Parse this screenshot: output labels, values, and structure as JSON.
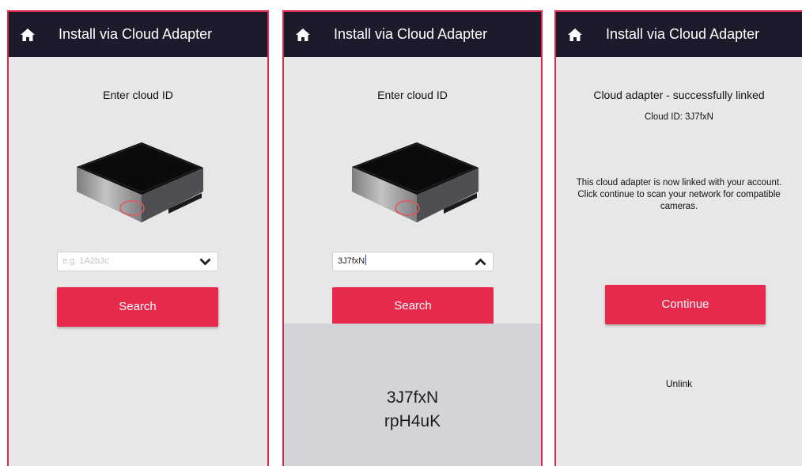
{
  "app_title": "Install via Cloud Adapter",
  "colors": {
    "accent": "#e7294c",
    "topbar": "#1b1b2c",
    "background": "#e7e7e8"
  },
  "icons": {
    "home": "home-icon",
    "dropdown_closed": "chevron-down-icon",
    "dropdown_open": "chevron-up-icon"
  },
  "screen1": {
    "heading": "Enter cloud ID",
    "dropdown_placeholder": "e.g. 1A2b3c",
    "search_label": "Search"
  },
  "screen2": {
    "heading": "Enter cloud ID",
    "dropdown_value": "3J7fxN",
    "search_label": "Search",
    "picker_options": [
      "3J7fxN",
      "rpH4uK"
    ]
  },
  "screen3": {
    "heading": "Cloud adapter - successfully linked",
    "cloud_id": "Cloud ID: 3J7fxN",
    "message": "This cloud adapter is now linked with your account. Click continue to scan your network for compatible cameras.",
    "continue_label": "Continue",
    "unlink_label": "Unlink"
  }
}
